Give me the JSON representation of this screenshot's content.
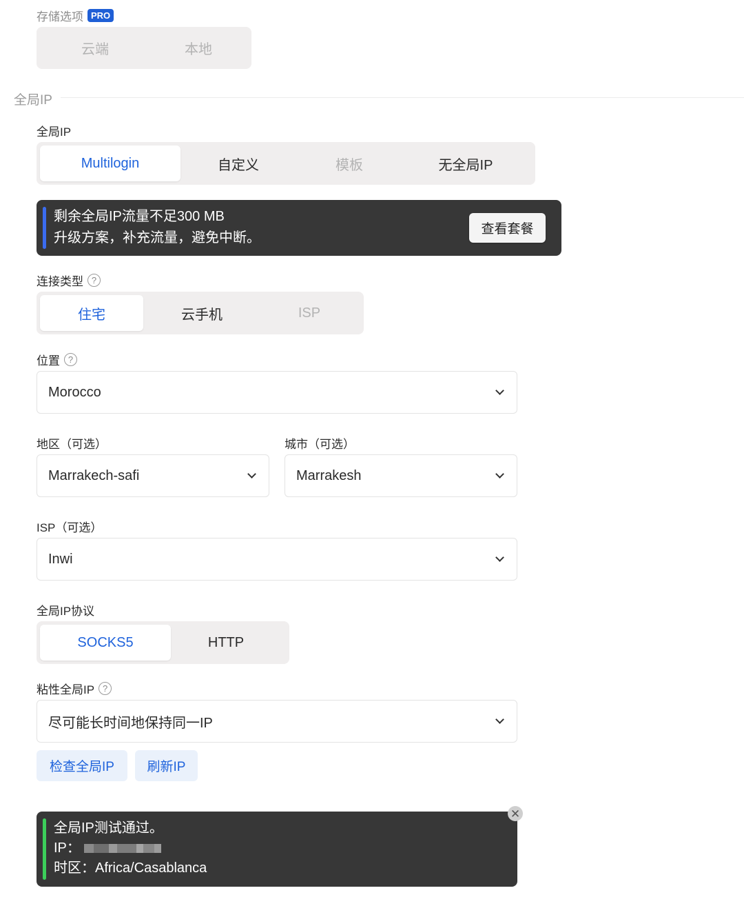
{
  "storage": {
    "label": "存储选项",
    "badge": "PRO",
    "options": [
      "云端",
      "本地"
    ]
  },
  "section": {
    "title": "全局IP"
  },
  "global_ip": {
    "label": "全局IP",
    "options": [
      "Multilogin",
      "自定义",
      "模板",
      "无全局IP"
    ],
    "selected": "Multilogin"
  },
  "warning_banner": {
    "line1": "剩余全局IP流量不足300 MB",
    "line2": "升级方案，补充流量，避免中断。",
    "button": "查看套餐",
    "accent_color": "#3b6cf0"
  },
  "connection_type": {
    "label": "连接类型",
    "options": [
      "住宅",
      "云手机",
      "ISP"
    ],
    "selected": "住宅"
  },
  "location": {
    "label": "位置",
    "value": "Morocco"
  },
  "region": {
    "label": "地区（可选）",
    "value": "Marrakech-safi"
  },
  "city": {
    "label": "城市（可选）",
    "value": "Marrakesh"
  },
  "isp": {
    "label": "ISP（可选）",
    "value": "Inwi"
  },
  "protocol": {
    "label": "全局IP协议",
    "options": [
      "SOCKS5",
      "HTTP"
    ],
    "selected": "SOCKS5"
  },
  "sticky": {
    "label": "粘性全局IP",
    "value": "尽可能长时间地保持同一IP"
  },
  "actions": {
    "check": "检查全局IP",
    "refresh": "刷新IP"
  },
  "result_banner": {
    "line1": "全局IP测试通过。",
    "ip_label": "IP：",
    "timezone_label": "时区：",
    "timezone_value": "Africa/Casablanca",
    "accent_color": "#3ccf5a",
    "close_icon": "close-icon"
  },
  "colors": {
    "primary": "#1f63dc",
    "banner_bg": "#373737"
  }
}
